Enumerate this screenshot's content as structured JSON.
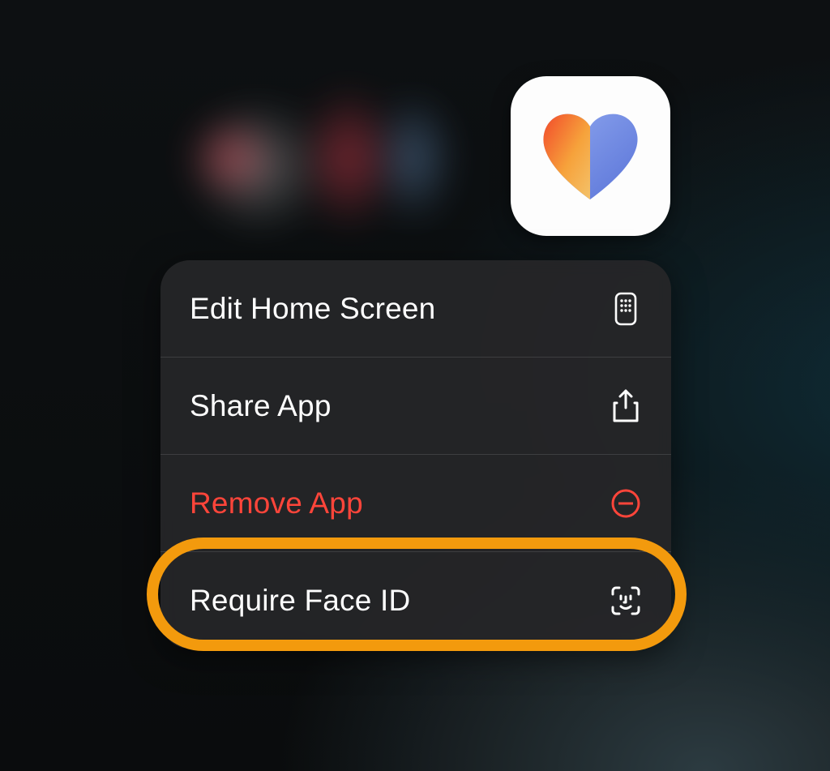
{
  "menu": {
    "items": [
      {
        "label": "Edit Home Screen",
        "icon": "apps-grid-icon",
        "destructive": false
      },
      {
        "label": "Share App",
        "icon": "share-icon",
        "destructive": false
      },
      {
        "label": "Remove App",
        "icon": "remove-icon",
        "destructive": true
      },
      {
        "label": "Require Face ID",
        "icon": "face-id-icon",
        "destructive": false
      }
    ]
  },
  "highlight_index": 3,
  "colors": {
    "destructive": "#ff453a",
    "highlight": "#f39a0d"
  }
}
